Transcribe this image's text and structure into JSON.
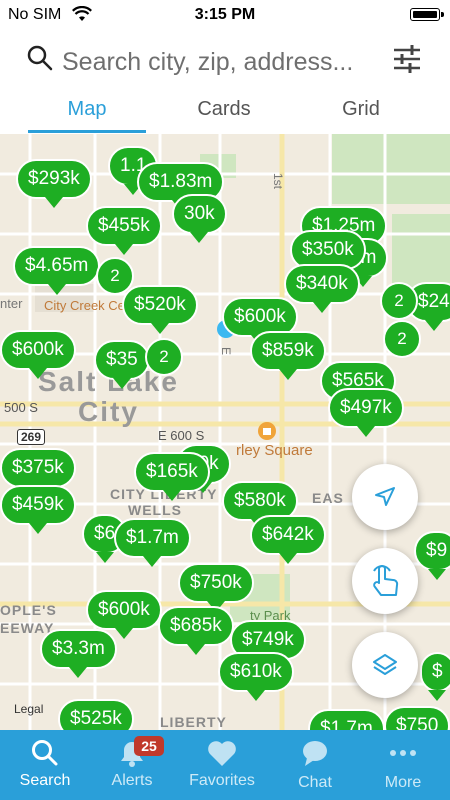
{
  "status": {
    "carrier": "No SIM",
    "time": "3:15 PM"
  },
  "search": {
    "placeholder": "Search city, zip, address..."
  },
  "tabs": [
    {
      "label": "Map",
      "active": true
    },
    {
      "label": "Cards",
      "active": false
    },
    {
      "label": "Grid",
      "active": false
    }
  ],
  "map": {
    "labels": {
      "city_creek": "City Creek Center",
      "salt_lake": "Salt Lake",
      "city": "City",
      "street_500s": "500 S",
      "e600s": "E 600 S",
      "route_269": "269",
      "square": "rley Square",
      "liberty": "LIBERTY",
      "peoples": "OPLE'S",
      "eeway": "EEWAY",
      "wells": "WELLS",
      "liberty_city": "CITY LIBERTY",
      "legal": "Legal",
      "first_st": "1st",
      "park": "ty Park",
      "eas": "EAS",
      "nter": "nter",
      "e_letter": "E"
    },
    "pins": [
      {
        "label": "$293k"
      },
      {
        "label": "$1.83m"
      },
      {
        "label": "$455k"
      },
      {
        "label": "30k"
      },
      {
        "label": "$4.65m"
      },
      {
        "label": "$520k"
      },
      {
        "label": "$600k"
      },
      {
        "label": "$35"
      },
      {
        "label": "$1.25m"
      },
      {
        "label": "$350k"
      },
      {
        "label": "$340k"
      },
      {
        "label": "$600k"
      },
      {
        "label": "$859k"
      },
      {
        "label": "$565k"
      },
      {
        "label": "$497k"
      },
      {
        "label": "$24"
      },
      {
        "label": "$375k"
      },
      {
        "label": "$459k"
      },
      {
        "label": "$165k"
      },
      {
        "label": "00k"
      },
      {
        "label": "$580k"
      },
      {
        "label": "$642k"
      },
      {
        "label": "$6"
      },
      {
        "label": "$1.7m"
      },
      {
        "label": "$750k"
      },
      {
        "label": "$600k"
      },
      {
        "label": "$685k"
      },
      {
        "label": "$749k"
      },
      {
        "label": "$3.3m"
      },
      {
        "label": "$610k"
      },
      {
        "label": "$525k"
      },
      {
        "label": "$1.7m"
      },
      {
        "label": "$750"
      },
      {
        "label": "$9"
      },
      {
        "label": "$"
      },
      {
        "label": "1.1"
      },
      {
        "label": "5m"
      },
      {
        "label": "2"
      }
    ],
    "clusters": [
      {
        "label": "2"
      },
      {
        "label": "2"
      },
      {
        "label": "2"
      },
      {
        "label": "2"
      }
    ]
  },
  "nav": [
    {
      "label": "Search",
      "icon": "search-icon",
      "active": true
    },
    {
      "label": "Alerts",
      "icon": "bell-icon",
      "badge": "25"
    },
    {
      "label": "Favorites",
      "icon": "heart-icon"
    },
    {
      "label": "Chat",
      "icon": "chat-icon"
    },
    {
      "label": "More",
      "icon": "more-icon"
    }
  ],
  "colors": {
    "accent": "#2a9fd9",
    "pin": "#1eae23",
    "badge": "#c0392b"
  }
}
